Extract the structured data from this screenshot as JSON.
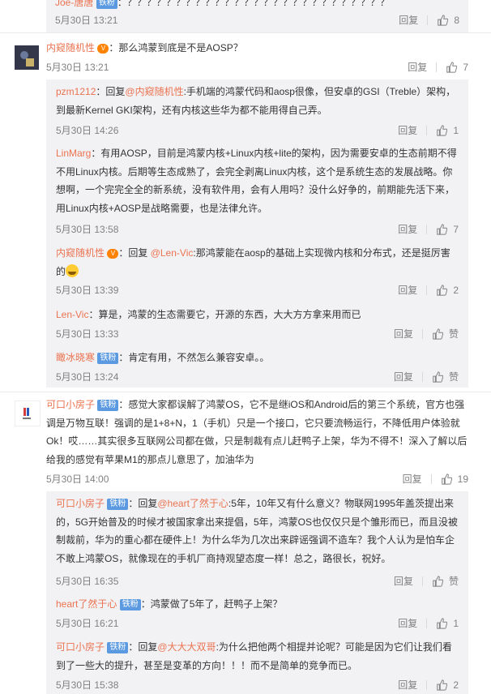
{
  "comments": [
    {
      "user": "Joe-唐唐",
      "badge": "铁粉",
      "text": "：？？？？？？？？？？？？？？？？？？？？？？？？？？？",
      "date": "5月30日 13:21",
      "reply": "回复",
      "likes": "8"
    },
    {
      "user": "内窥随机性",
      "text": "：那么鸿蒙到底是不是AOSP？",
      "date": "5月30日 13:21",
      "reply": "回复",
      "likes": "7",
      "replies": [
        {
          "user": "pzm1212",
          "pre": "：回复",
          "mention": "@内窥随机性",
          "text": ":手机端的鸿蒙代码和aosp很像，但安卓的GSI（Treble）架构，到最新Kernel GKI架构，还有内核这些华为都不能用得自己弄。",
          "date": "5月30日 14:26",
          "reply": "回复",
          "likes": "1"
        },
        {
          "user": "LinMarg",
          "text": "：有用AOSP，目前是鸿蒙内核+Linux内核+lite的架构，因为需要安卓的生态前期不得不用Linux内核。后期等生态成熟了，会完全剥离Linux内核，这个是系统生态的发展战略。你想啊，一个完完全全的新系统，没有软件用，会有人用吗？没什么好争的，前期能先活下来，用Linux内核+AOSP是战略需要，也是法律允许。",
          "date": "5月30日 13:58",
          "reply": "回复",
          "likes": "7"
        },
        {
          "user": "内窥随机性",
          "pre": "：回复 ",
          "mention": "@Len-Vic",
          "text": ":那鸿蒙能在aosp的基础上实现微内核和分布式，还是挺厉害的",
          "date": "5月30日 13:39",
          "reply": "回复",
          "likes": "2"
        },
        {
          "user": "Len-Vic",
          "text": "：算是，鸿蒙的生态需要它，开源的东西，大大方方拿来用而已",
          "date": "5月30日 13:33",
          "reply": "回复",
          "likes": "赞"
        },
        {
          "user": "瞰冰晓寒",
          "badge": "铁粉",
          "text": "：肯定有用，不然怎么兼容安卓。。",
          "date": "5月30日 13:24",
          "reply": "回复",
          "likes": "赞"
        }
      ]
    },
    {
      "user": "可口小房子",
      "badge": "铁粉",
      "text": "：感觉大家都误解了鸿蒙OS，它不是继iOS和Android后的第三个系统，官方也强调是万物互联！强调的是1+8+N，1（手机）只是一个接口，它只要流畅运行，不降低用户体验就Ok！哎……其实很多互联网公司都在做，只是制裁有点儿赶鸭子上架，华为不得不！深入了解以后给我的感觉有苹果M1的那点儿意思了，加油华为",
      "date": "5月30日 14:00",
      "reply": "回复",
      "likes": "19",
      "replies": [
        {
          "user": "可口小房子",
          "badge": "铁粉",
          "pre": "：回复",
          "mention": "@heart了然于心",
          "text": ":5年，10年又有什么意义？物联网1995年盖茨提出来的，5G开始普及的时候才被国家拿出来提倡，5年，鸿蒙OS也仅仅只是个雏形而已，而且没被制裁前，华为的重心都在硬件上！为什么华为几次出来辟谣强调不造车？我个人认为是怕车企不敢上鸿蒙OS，就像现在的手机厂商持观望态度一样！总之，路很长，祝好。",
          "date": "5月30日 16:35",
          "reply": "回复",
          "likes": "赞"
        },
        {
          "user": "heart了然于心",
          "badge": "铁粉",
          "text": "：鸿蒙做了5年了，赶鸭子上架？",
          "date": "5月30日 16:21",
          "reply": "回复",
          "likes": "1"
        },
        {
          "user": "可口小房子",
          "badge": "铁粉",
          "pre": "：回复",
          "mention": "@大大大双哥",
          "text": ":为什么把他两个相提并论呢？可能是因为它们让我们看到了一些大的提升，甚至是变革的方向！！！而不是简单的竞争而已。",
          "date": "5月30日 15:38",
          "reply": "回复",
          "likes": "2"
        }
      ]
    }
  ]
}
